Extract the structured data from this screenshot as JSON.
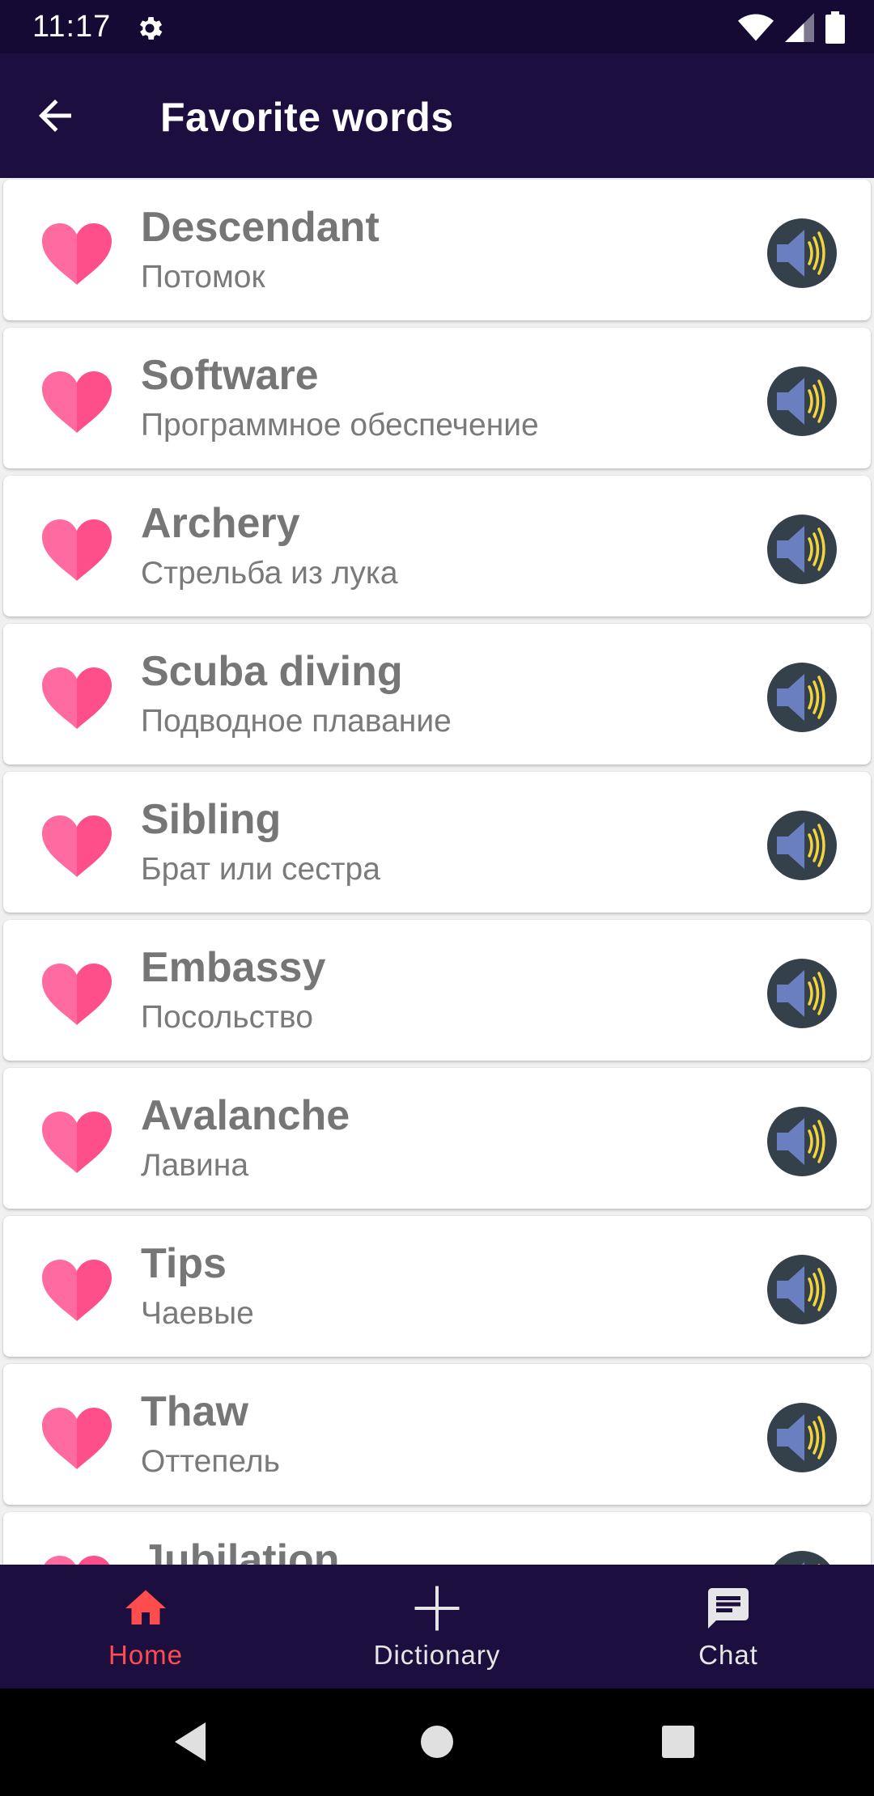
{
  "status_bar": {
    "time": "11:17",
    "icons": [
      "settings-gear-icon",
      "wifi-icon",
      "cell-signal-icon",
      "battery-icon"
    ]
  },
  "app_bar": {
    "title": "Favorite words",
    "back_icon": "arrow-back-icon"
  },
  "words": [
    {
      "word": "Descendant",
      "translation": "Потомок"
    },
    {
      "word": "Software",
      "translation": "Программное обеспечение"
    },
    {
      "word": "Archery",
      "translation": "Стрельба из лука"
    },
    {
      "word": "Scuba diving",
      "translation": "Подводное плавание"
    },
    {
      "word": "Sibling",
      "translation": "Брат или сестра"
    },
    {
      "word": "Embassy",
      "translation": "Посольство"
    },
    {
      "word": "Avalanche",
      "translation": "Лавина"
    },
    {
      "word": "Tips",
      "translation": "Чаевые"
    },
    {
      "word": "Thaw",
      "translation": "Оттепель"
    },
    {
      "word": "Jubilation",
      "translation": ""
    }
  ],
  "bottom_nav": {
    "items": [
      {
        "label": "Home",
        "icon": "home-icon",
        "active": true
      },
      {
        "label": "Dictionary",
        "icon": "plus-icon",
        "active": false
      },
      {
        "label": "Chat",
        "icon": "chat-icon",
        "active": false
      }
    ]
  },
  "system_nav": {
    "icons": [
      "back-triangle-icon",
      "home-circle-icon",
      "recents-square-icon"
    ]
  },
  "colors": {
    "status_bar_bg": "#140a33",
    "app_bar_bg": "#1c0f3f",
    "heart": "#ff4f8b",
    "speaker_bg": "#34404a",
    "speaker_cone": "#6a7fc0",
    "speaker_waves": "#f2d43c",
    "nav_active": "#ff4d4d",
    "nav_inactive": "#e6e6e6",
    "word_text": "#767676"
  }
}
